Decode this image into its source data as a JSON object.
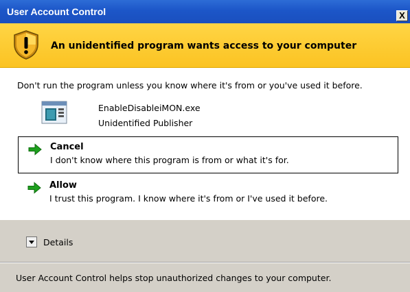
{
  "window": {
    "title": "User Account Control",
    "close_label": "X"
  },
  "banner": {
    "icon": "shield-warning-icon",
    "headline": "An unidentified program wants access to your computer"
  },
  "body": {
    "warning": "Don't run the program unless you know where it's from or you've used it before.",
    "program": {
      "icon": "program-window-icon",
      "name": "EnableDisableiMON.exe",
      "publisher": "Unidentified Publisher"
    }
  },
  "options": [
    {
      "icon": "green-arrow-icon",
      "title": "Cancel",
      "description": "I don't know where this program is from or what it's for."
    },
    {
      "icon": "green-arrow-icon",
      "title": "Allow",
      "description": "I trust this program. I know where it's from or I've used it before."
    }
  ],
  "footer": {
    "details_label": "Details",
    "details_icon": "chevron-down-icon",
    "info": "User Account Control helps stop unauthorized changes to your computer."
  },
  "colors": {
    "titlebar": "#1c56c8",
    "banner": "#fbc322",
    "arrow": "#1ea01e",
    "footer": "#d4d0c8"
  }
}
